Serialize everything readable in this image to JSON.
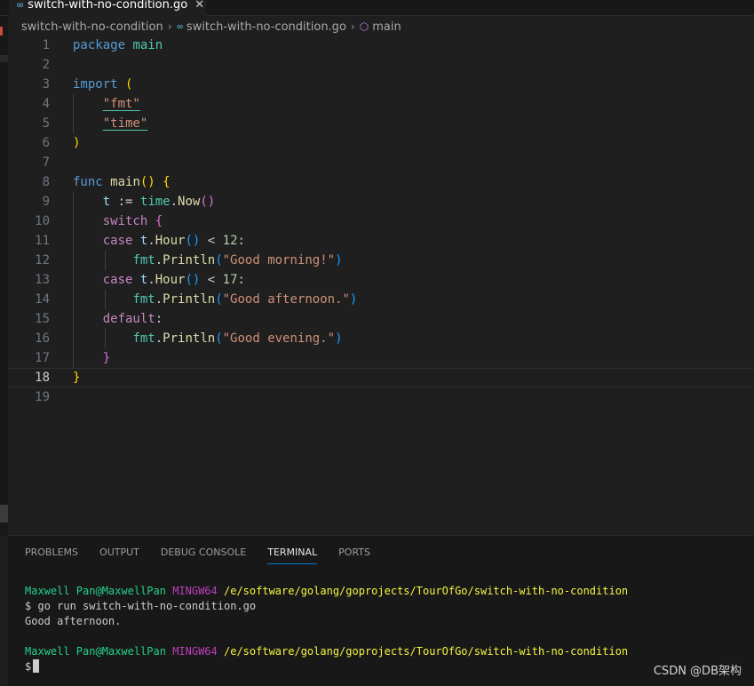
{
  "tab": {
    "file": "switch-with-no-condition.go",
    "icon": "go-file-icon"
  },
  "breadcrumb": {
    "folder": "switch-with-no-condition",
    "file": "switch-with-no-condition.go",
    "symbol": "main"
  },
  "editor": {
    "current_line": 18,
    "lines": [
      {
        "n": "1"
      },
      {
        "n": "2"
      },
      {
        "n": "3"
      },
      {
        "n": "4"
      },
      {
        "n": "5"
      },
      {
        "n": "6"
      },
      {
        "n": "7"
      },
      {
        "n": "8"
      },
      {
        "n": "9"
      },
      {
        "n": "10"
      },
      {
        "n": "11"
      },
      {
        "n": "12"
      },
      {
        "n": "13"
      },
      {
        "n": "14"
      },
      {
        "n": "15"
      },
      {
        "n": "16"
      },
      {
        "n": "17"
      },
      {
        "n": "18"
      },
      {
        "n": "19"
      }
    ],
    "tokens": {
      "package": "package",
      "main": "main",
      "import": "import",
      "fmt": "\"fmt\"",
      "time": "\"time\"",
      "func": "func",
      "t": "t",
      "assign": ":=",
      "time_pkg": "time",
      "now": "Now",
      "switch": "switch",
      "case": "case",
      "hour": "Hour",
      "lt": "<",
      "n12": "12",
      "n17": "17",
      "fmt_pkg": "fmt",
      "println": "Println",
      "s_morning": "\"Good morning!\"",
      "s_afternoon": "\"Good afternoon.\"",
      "s_evening": "\"Good evening.\"",
      "default": "default"
    }
  },
  "panel": {
    "tabs": [
      "PROBLEMS",
      "OUTPUT",
      "DEBUG CONSOLE",
      "TERMINAL",
      "PORTS"
    ],
    "active_tab": "TERMINAL"
  },
  "terminal": {
    "user": "Maxwell Pan@MaxwellPan",
    "shell": "MINGW64",
    "path": "/e/software/golang/goprojects/TourOfGo/switch-with-no-condition",
    "prompt": "$",
    "command": "go run switch-with-no-condition.go",
    "output": "Good afternoon."
  },
  "watermark": "CSDN @DB架构",
  "colors": {
    "accent": "#0078d4",
    "background": "#1f1f1f",
    "panel": "#181818"
  }
}
